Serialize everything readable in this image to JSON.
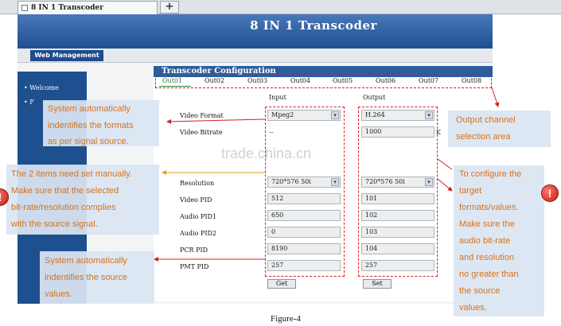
{
  "browser": {
    "tab_title": "8 IN 1 Transcoder",
    "new_tab_glyph": "+"
  },
  "header": {
    "title": "8 IN 1 Transcoder"
  },
  "menu": {
    "web_management": "Web Management"
  },
  "sidebar": {
    "items": [
      "• Welcome",
      "• F"
    ]
  },
  "config": {
    "title": "Transcoder Configuration",
    "tabs": [
      "Out01",
      "Out02",
      "Out03",
      "Out04",
      "Out05",
      "Out06",
      "Out07",
      "Out08"
    ],
    "columns": {
      "input": "Input",
      "output": "Output"
    },
    "rows": [
      {
        "label": "Video Format",
        "input": "Mpeg2",
        "output": "H.264"
      },
      {
        "label": "Video Bitrate",
        "input": "--",
        "output": "1000",
        "unit": "K"
      },
      {
        "label": "Resolution",
        "input": "720*576 50i",
        "output": "720*576 50i"
      },
      {
        "label": "Video PID",
        "input": "512",
        "output": "101"
      },
      {
        "label": "Audio PID1",
        "input": "650",
        "output": "102"
      },
      {
        "label": "Audio PID2",
        "input": "0",
        "output": "103"
      },
      {
        "label": "PCR PID",
        "input": "8190",
        "output": "104"
      },
      {
        "label": "PMT PID",
        "input": "257",
        "output": "257"
      }
    ],
    "get_button": "Get",
    "set_button": "Set"
  },
  "callouts": {
    "formats": [
      "System automatically",
      "indentifies the formats",
      "as per signal source."
    ],
    "manual": [
      "The 2 items need set manually.",
      "Make sure that the selected",
      "bit-rate/resolution complies",
      "with the source signal."
    ],
    "source_values": [
      "System automatically",
      "indentifies the source",
      "values."
    ],
    "output_channel": [
      "Output channel",
      "selection area"
    ],
    "target": [
      "To configure the",
      "target",
      "formats/values.",
      "Make sure the",
      "audio bit-rate",
      "and resolution",
      "no greater than",
      "the source",
      "values."
    ]
  },
  "warning_glyph": "!",
  "watermark": "trade.china.cn",
  "caption": "Figure-4",
  "colors": {
    "annotation": "#d32020",
    "callout_text": "#d8721a",
    "header_blue": "#1f4f8f"
  }
}
